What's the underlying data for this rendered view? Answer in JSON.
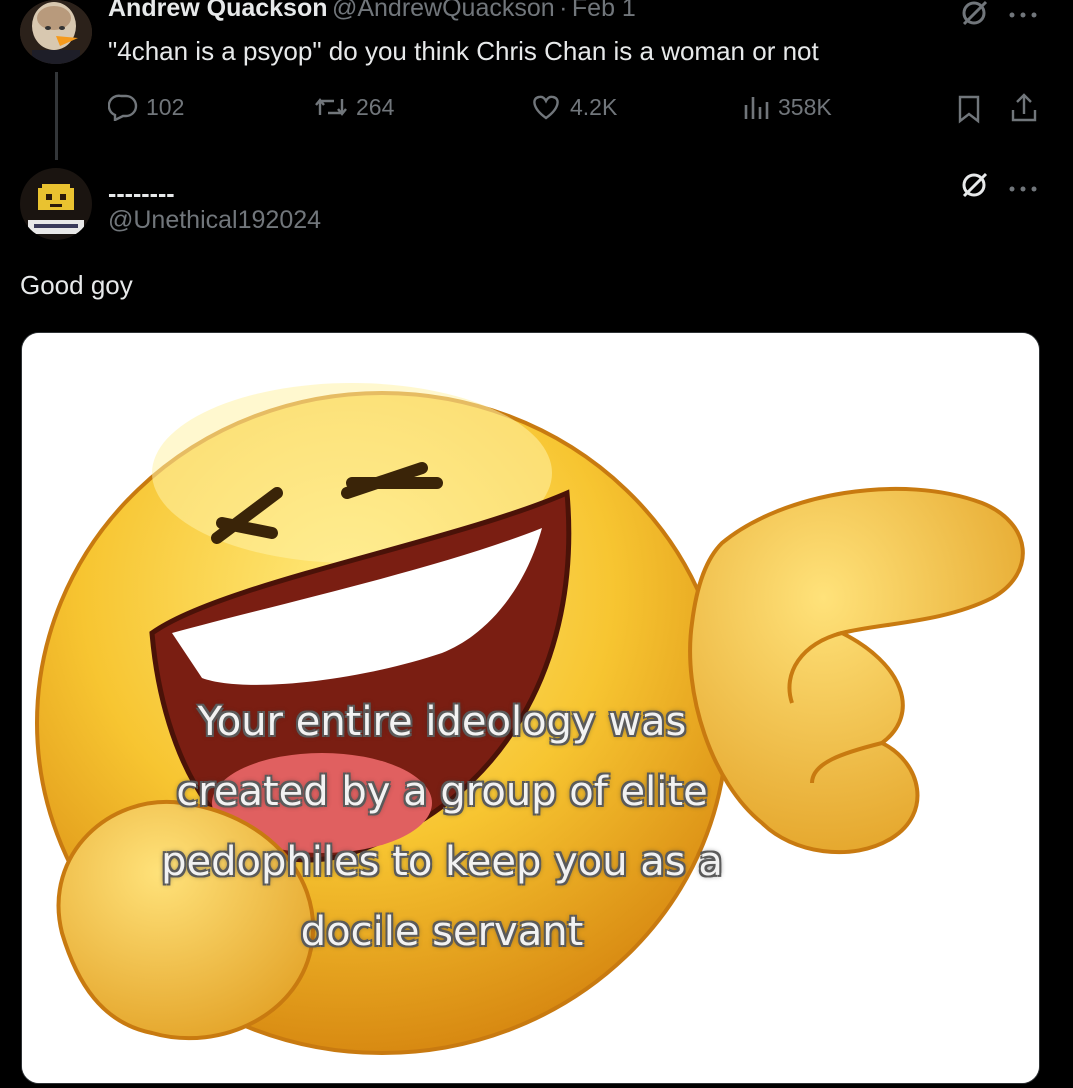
{
  "parent_tweet": {
    "display_name": "Andrew Quackson",
    "handle": "@AndrewQuackson",
    "separator": "·",
    "date": "Feb 1",
    "text": "\"4chan is a psyop\" do you think Chris Chan is a woman or not",
    "replies": "102",
    "reposts": "264",
    "likes": "4.2K",
    "views": "358K"
  },
  "reply_tweet": {
    "display_name": "--------",
    "handle": "@Unethical192024",
    "text": "Good goy",
    "media": {
      "caption_lines": [
        "Your entire ideology was",
        "created by a group of elite",
        "pedophiles to keep you as a",
        "docile servant"
      ]
    }
  },
  "colors": {
    "background": "#000000",
    "primary_text": "#e7e9ea",
    "secondary_text": "#71767b",
    "emoji_yellow": "#f7c531"
  },
  "icons": [
    "grok-icon",
    "more-icon",
    "reply-icon",
    "repost-icon",
    "like-icon",
    "views-icon",
    "bookmark-icon",
    "share-icon"
  ]
}
